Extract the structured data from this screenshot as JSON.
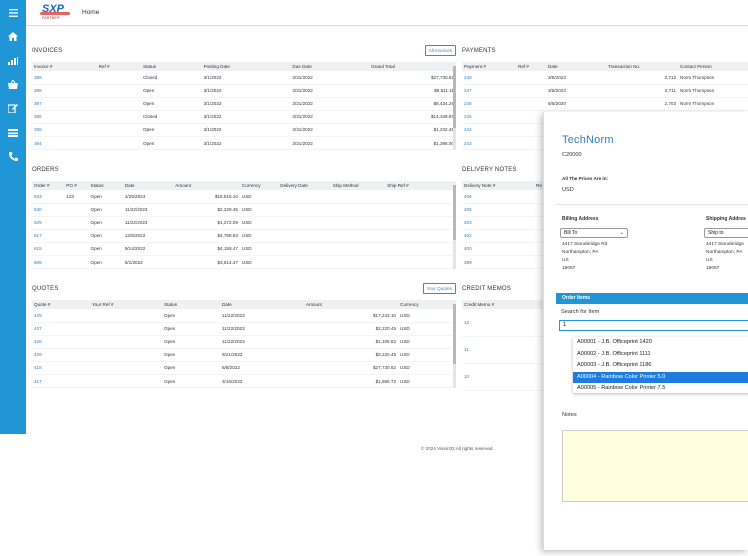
{
  "app": {
    "logo_text": "SXP",
    "logo_sub": "PARTNER",
    "home_label": "Home",
    "footer": "© 2024 Vision33 All rights reserved."
  },
  "sidebar": {
    "icons": [
      "menu-icon",
      "home-icon",
      "chart-icon",
      "shop-icon",
      "edit-icon",
      "card-icon",
      "phone-icon"
    ]
  },
  "invoices": {
    "title": "INVOICES",
    "button": "All Invoices",
    "columns": [
      "Invoice #",
      "Ref #",
      "Status",
      "Posting Date",
      "Due Date",
      "Grand Total"
    ],
    "rows": [
      [
        "399",
        "",
        "Closed",
        "3/1/2022",
        "3/31/2022",
        "$27,730.62"
      ],
      [
        "398",
        "",
        "Open",
        "3/1/2022",
        "3/31/2022",
        "$9,811.11"
      ],
      [
        "397",
        "",
        "Open",
        "3/1/2022",
        "3/31/2022",
        "$8,434.26"
      ],
      [
        "396",
        "",
        "Closed",
        "3/1/2022",
        "3/31/2022",
        "$14,349.87"
      ],
      [
        "395",
        "",
        "Open",
        "3/1/2022",
        "3/31/2022",
        "$1,232.49"
      ],
      [
        "394",
        "",
        "Open",
        "3/1/2022",
        "3/31/2022",
        "$1,395.00"
      ]
    ]
  },
  "payments": {
    "title": "PAYMENTS",
    "columns": [
      "Payment #",
      "Ref #",
      "Date",
      "Transaction No.",
      "Contact Person"
    ],
    "rows": [
      [
        "248",
        "",
        "3/8/2022",
        "2,712",
        "Norm Thompson"
      ],
      [
        "247",
        "",
        "3/8/2022",
        "2,711",
        "Norm Thompson"
      ],
      [
        "246",
        "",
        "8/5/2020",
        "2,703",
        "Norm Thompson"
      ],
      [
        "245",
        "",
        "",
        "",
        ""
      ],
      [
        "244",
        "",
        "",
        "",
        ""
      ],
      [
        "243",
        "",
        "",
        "",
        ""
      ]
    ]
  },
  "orders": {
    "title": "ORDERS",
    "columns": [
      "Order #",
      "PO #",
      "Status",
      "Date",
      "Amount",
      "Currency",
      "Delivery Date",
      "Ship Method",
      "Ship Ref #"
    ],
    "rows": [
      [
        "633",
        "123",
        "Open",
        "1/25/2024",
        "$18,515.10",
        "USD",
        "",
        "",
        ""
      ],
      [
        "630",
        "",
        "Open",
        "11/22/2023",
        "$2,229.45",
        "USD",
        "",
        "",
        ""
      ],
      [
        "629",
        "",
        "Open",
        "11/22/2023",
        "$1,272.09",
        "USD",
        "",
        "",
        ""
      ],
      [
        "617",
        "",
        "Open",
        "12/5/2022",
        "$4,768.63",
        "USD",
        "",
        "",
        ""
      ],
      [
        "615",
        "",
        "Open",
        "9/14/2022",
        "$4,159.47",
        "USD",
        "",
        "",
        ""
      ],
      [
        "609",
        "",
        "Open",
        "6/1/2022",
        "$3,614.47",
        "USD",
        "",
        "",
        ""
      ]
    ]
  },
  "delivery": {
    "title": "DELIVERY NOTES",
    "columns": [
      "Delivery Note #",
      "Re"
    ],
    "rows": [
      [
        "406",
        ""
      ],
      [
        "405",
        ""
      ],
      [
        "403",
        ""
      ],
      [
        "402",
        ""
      ],
      [
        "400",
        ""
      ],
      [
        "399",
        ""
      ]
    ]
  },
  "quotes": {
    "title": "QUOTES",
    "button": "Your Quotes",
    "columns": [
      "Quote #",
      "Your Ref #",
      "Status",
      "Date",
      "Amount",
      "Currency"
    ],
    "rows": [
      [
        "428",
        "",
        "Open",
        "11/22/2023",
        "$17,243.10",
        "USD"
      ],
      [
        "427",
        "",
        "Open",
        "11/22/2023",
        "$2,220.45",
        "USD"
      ],
      [
        "426",
        "",
        "Open",
        "11/22/2023",
        "$1,109.82",
        "USD"
      ],
      [
        "429",
        "",
        "Open",
        "9/21/2022",
        "$2,220.45",
        "USD"
      ],
      [
        "418",
        "",
        "Open",
        "6/8/2022",
        "$27,730.62",
        "USD"
      ],
      [
        "417",
        "",
        "Open",
        "3/16/2022",
        "$1,866.72",
        "USD"
      ]
    ]
  },
  "credit": {
    "title": "CREDIT MEMOS",
    "columns": [
      "Credit Memo #"
    ],
    "rows": [
      [
        "12"
      ],
      [
        "11"
      ],
      [
        "10"
      ]
    ]
  },
  "modal": {
    "company": "TechNorm",
    "code": "C20000",
    "prices_label": "All The Prices Are In:",
    "currency": "USD",
    "billing": {
      "label": "Billing Address",
      "select": "Bill To",
      "lines": [
        "4417 Stonebridge Rd",
        "Northampton, PA",
        "US",
        "18067"
      ]
    },
    "shipping": {
      "label": "Shipping Addres",
      "select": "Ship to",
      "lines": [
        "4417 Stonebridge",
        "Northampton, PA",
        "US",
        "18067"
      ]
    },
    "items_bar": "Order Items",
    "search_label": "Search for Item",
    "search_value": "1",
    "dropdown": [
      "A00001 - J.B. Officeprint 1420",
      "A00002 - J.B. Officeprint 1111",
      "A00003 - J.B. Officeprint 1186",
      "A00004 - Rainbow Color Printer 5.0",
      "A00005 - Rainbow Color Printer 7.5"
    ],
    "dropdown_selected_index": 3,
    "notes_label": "Notes"
  }
}
